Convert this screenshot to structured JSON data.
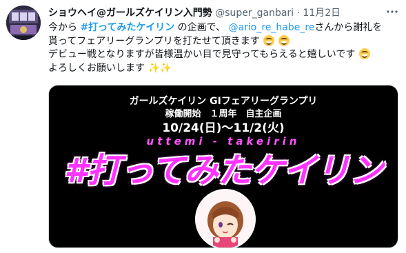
{
  "author": {
    "name": "ショウヘイ@ガールズケイリン入門勢",
    "handle": "@super_ganbari",
    "separator": "·",
    "date": "11月2日"
  },
  "icons": {
    "more": "more-icon",
    "avatar": "avatar",
    "emoji": "grinning-squinting-face-icon",
    "sparkles": "sparkles-icon"
  },
  "tweet": {
    "line1_prefix": "今から",
    "hashtag": "#打ってみたケイリン",
    "line1_mid": "の企画で、",
    "mention": "@ario_re_habe_re",
    "line1_suffix": "さんから謝礼を",
    "line2": "貰ってフェアリーグランプリを打たせて頂きます",
    "line3": "デビュー戦となりますが皆様温かい目で見守ってもらえると嬉しいです",
    "line4": "よろしくお願いします",
    "sparkle_glyph": "✨"
  },
  "media": {
    "title": "ガールズケイリン GⅠフェアリーグランプリ",
    "subtitle": "稼働開始　１周年　自主企画",
    "dates": "10/24(日)～11/2(火)",
    "romaji": "uttemi - takeirin",
    "big_text": "#打ってみたケイリン"
  },
  "colors": {
    "link": "#1d9bf0",
    "text": "#0f1419",
    "muted": "#536471",
    "media_bg": "#000000",
    "magenta": "#ff33ff"
  }
}
